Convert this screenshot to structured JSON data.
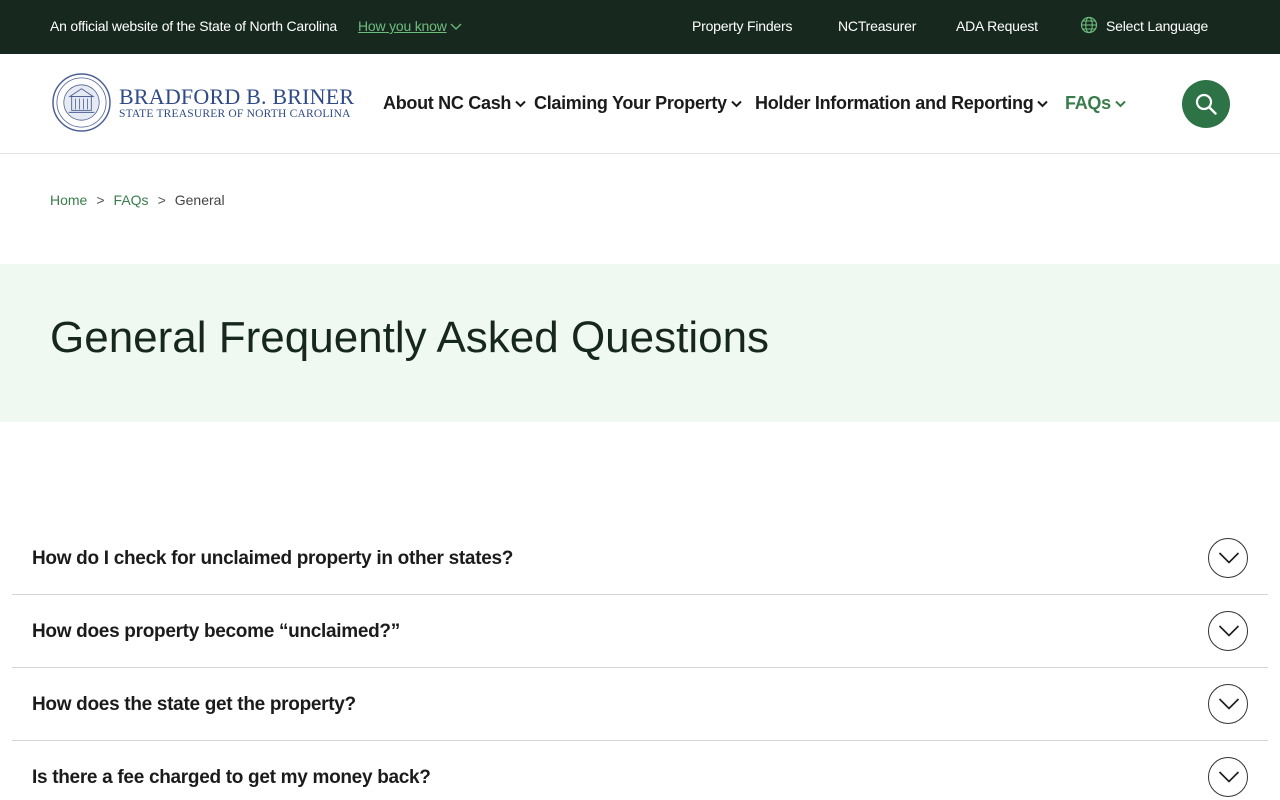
{
  "topbar": {
    "official_text": "An official website of the State of North Carolina",
    "how_you_know": "How you know",
    "links": [
      "Property Finders",
      "NCTreasurer",
      "ADA Request"
    ],
    "language": "Select Language"
  },
  "header": {
    "brand_name": "BRADFORD B. BRINER",
    "brand_sub": "STATE TREASURER OF NORTH CAROLINA",
    "nav": [
      "About NC Cash",
      "Claiming Your Property",
      "Holder Information and Reporting",
      "FAQs"
    ],
    "active_nav": "FAQs"
  },
  "breadcrumb": {
    "home": "Home",
    "faqs": "FAQs",
    "current": "General",
    "separator": ">"
  },
  "hero": {
    "title": "General Frequently Asked Questions"
  },
  "faqs": [
    {
      "question": "How do I check for unclaimed property in other states?"
    },
    {
      "question": "How does property become “unclaimed?”"
    },
    {
      "question": "How does the state get the property?"
    },
    {
      "question": "Is there a fee charged to get my money back?"
    }
  ],
  "colors": {
    "topbar_bg": "#17291f",
    "accent_green": "#2e7346",
    "link_green": "#3a7d4c",
    "hero_bg": "#f0f8f2",
    "brand_blue": "#2f4a86"
  },
  "icons": {
    "how_you_know": "chevron-down-icon",
    "language": "globe-icon",
    "nav_dropdown": "chevron-down-icon",
    "search": "search-icon",
    "faq_toggle": "chevron-down-icon"
  }
}
